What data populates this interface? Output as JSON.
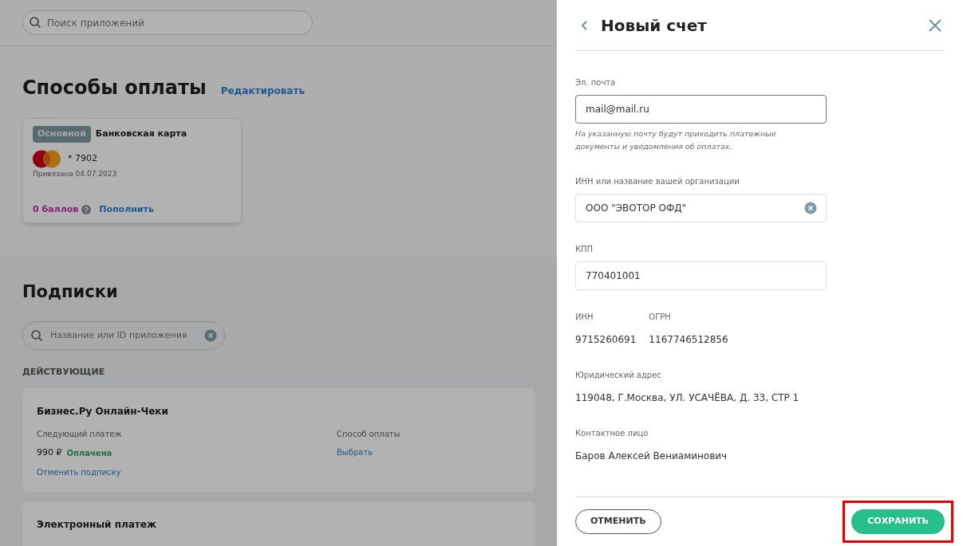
{
  "background": {
    "search": {
      "placeholder": "Поиск приложений"
    },
    "payment_methods": {
      "title": "Способы оплаты",
      "edit_link": "Редактировать",
      "card": {
        "badge": "Основной",
        "type": "Банковская карта",
        "number": "* 7902",
        "linked": "Привязана 04.07.2023",
        "points": "0 баллов",
        "top_up": "Пополнить"
      }
    },
    "subscriptions": {
      "title": "Подписки",
      "search": {
        "placeholder": "Название или ID приложения"
      },
      "section_label": "ДЕЙСТВУЮЩИЕ",
      "items": [
        {
          "name": "Бизнес.Ру Онлайн-Чеки",
          "next_payment_label": "Следующий платеж",
          "price": "990 ₽",
          "status": "Оплачена",
          "cancel_link": "Отменить подписку",
          "payment_method_label": "Способ оплаты",
          "choose_link": "Выбрать"
        },
        {
          "name": "Электронный платеж"
        }
      ]
    }
  },
  "panel": {
    "title": "Новый счет",
    "email": {
      "label": "Эл. почта",
      "value": "mail@mail.ru",
      "focused": true,
      "hint": "На указанную почту будут приходить платежные документы и уведомления об оплатах."
    },
    "organization": {
      "label": "ИНН или название вашей организации",
      "value": "ООО \"ЭВОТОР ОФД\""
    },
    "kpp": {
      "label": "КПП",
      "value": "770401001"
    },
    "details": [
      {
        "label": "ИНН",
        "value": "9715260691"
      },
      {
        "label": "ОГРН",
        "value": "1167746512856"
      }
    ],
    "address": {
      "label": "Юридический адрес",
      "value": "119048, Г.Москва, УЛ. УСАЧЁВА, Д. 33, СТР 1"
    },
    "contact": {
      "label": "Контактное лицо",
      "value": "Баров Алексей Вениаминович"
    },
    "buttons": [
      {
        "kind": "secondary",
        "label": "ОТМЕНИТЬ",
        "highlighted": false
      },
      {
        "kind": "primary",
        "label": "СОХРАНИТЬ",
        "highlighted": true
      }
    ]
  }
}
